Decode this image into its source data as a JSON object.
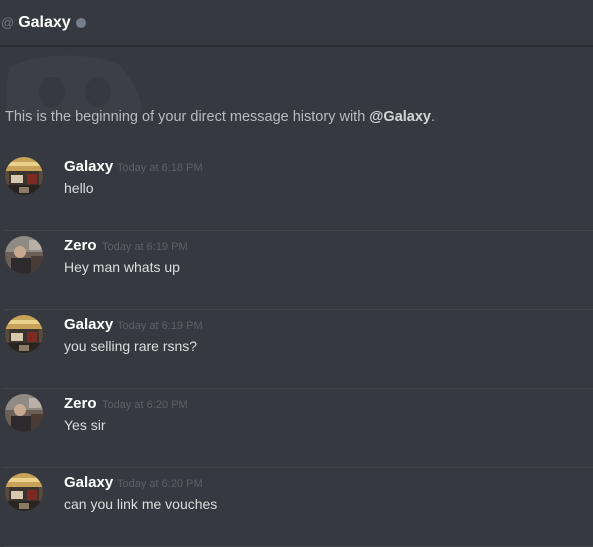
{
  "header": {
    "at_symbol": "@",
    "title": "Galaxy",
    "status_color": "#747f8d"
  },
  "intro": {
    "prefix": "This is the beginning of your direct message history with ",
    "mention": "@Galaxy",
    "suffix": "."
  },
  "messages": [
    {
      "author": "Galaxy",
      "timestamp": "Today at 6:18 PM",
      "text": "hello"
    },
    {
      "author": "Zero",
      "timestamp": "Today at 6:19 PM",
      "text": "Hey man whats up"
    },
    {
      "author": "Galaxy",
      "timestamp": "Today at 6:19 PM",
      "text": "you selling rare rsns?"
    },
    {
      "author": "Zero",
      "timestamp": "Today at 6:20 PM",
      "text": "Yes sir"
    },
    {
      "author": "Galaxy",
      "timestamp": "Today at 6:20 PM",
      "text": "can you link me vouches"
    }
  ],
  "colors": {
    "background": "#36393f",
    "username": "#ffffff",
    "timestamp": "#5d6066",
    "text": "#dcddde"
  },
  "icons": {
    "header_at": "at-icon",
    "status": "offline-status-icon",
    "intro_logo": "discord-logo-icon",
    "avatar_galaxy": "galaxy-avatar",
    "avatar_zero": "zero-avatar"
  }
}
